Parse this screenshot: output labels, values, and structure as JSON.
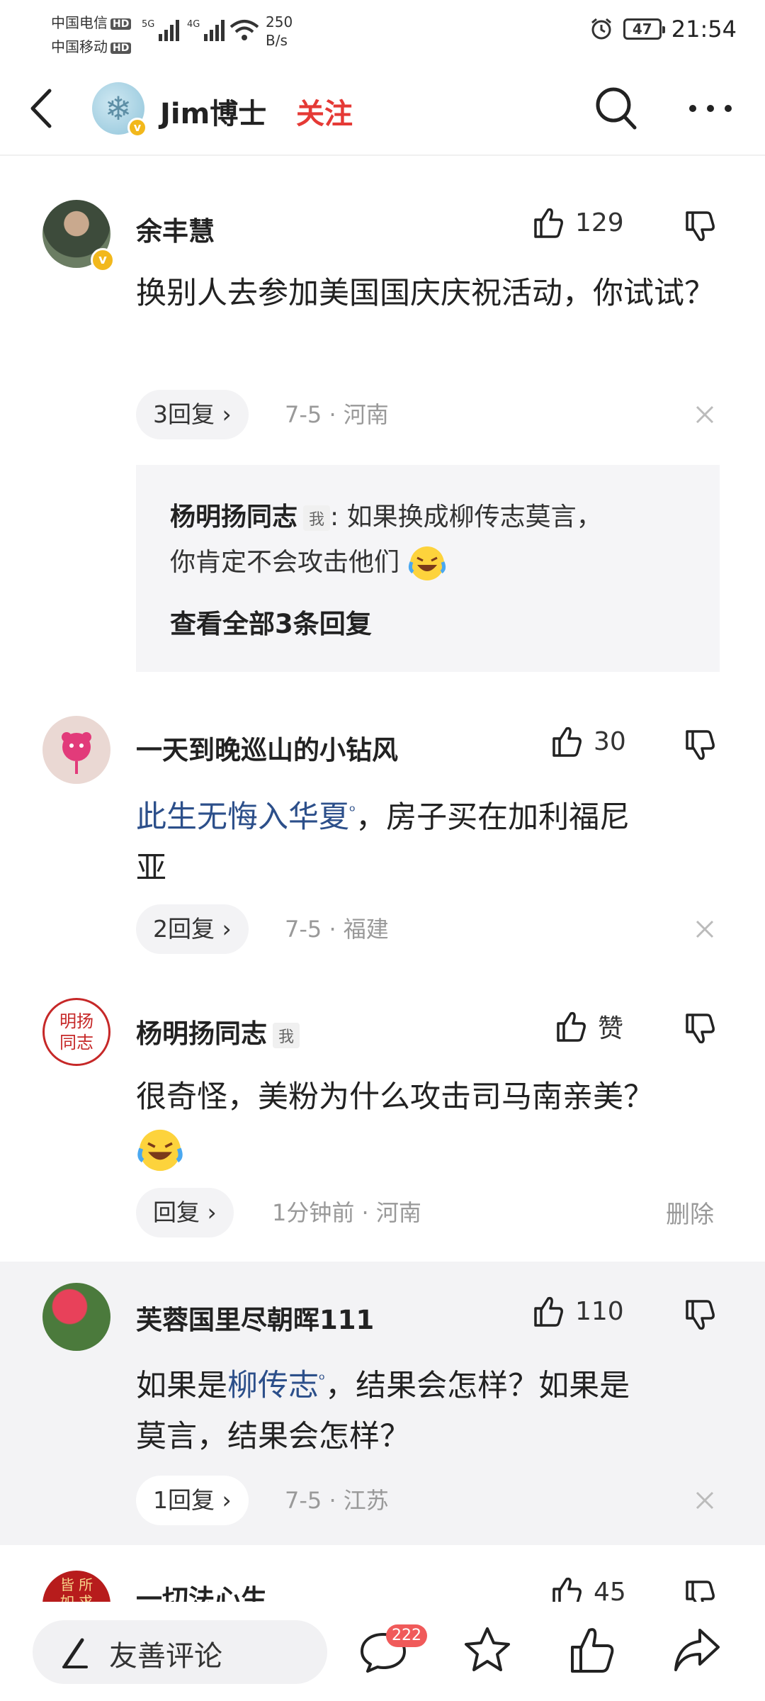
{
  "status_bar": {
    "carrier1": "中国电信",
    "carrier2": "中国移动",
    "hd": "HD",
    "sig1": "5G",
    "sig2": "4G",
    "speed_value": "250",
    "speed_unit": "B/s",
    "battery": "47",
    "time": "21:54"
  },
  "header": {
    "title": "Jim博士",
    "follow_label": "关注"
  },
  "comments": [
    {
      "name": "余丰慧",
      "likes": "129",
      "text": "换别人去参加美国国庆庆祝活动，你试试？",
      "replies_label": "3回复",
      "meta": "7-5 · 河南",
      "reply_preview": {
        "user": "杨明扬同志",
        "me_tag": "我",
        "text_line1": ": 如果换成柳传志莫言，",
        "text_line2": "你肯定不会攻击他们",
        "view_all": "查看全部3条回复"
      }
    },
    {
      "name": "一天到晚巡山的小钻风",
      "likes": "30",
      "text_link": "此生无悔入华夏",
      "text_rest_line1": "，房子买在加利福尼",
      "text_line2": "亚",
      "replies_label": "2回复",
      "meta": "7-5 · 福建"
    },
    {
      "name": "杨明扬同志",
      "me_tag": "我",
      "avatar_text_top": "明扬",
      "avatar_text_bottom": "同志",
      "likes": "赞",
      "text": "很奇怪，美粉为什么攻击司马南亲美？",
      "replies_label": "回复",
      "meta": "1分钟前 · 河南",
      "delete_label": "删除"
    },
    {
      "name": "芙蓉国里尽朝晖111",
      "likes": "110",
      "text_prefix": "如果是",
      "text_link": "柳传志",
      "text_rest_line1": "，结果会怎样？如果是",
      "text_line2": "莫言，结果会怎样？",
      "replies_label": "1回复",
      "meta": "7-5 · 江苏"
    },
    {
      "name": "一切法心生",
      "avatar_text_top": "皆 所",
      "avatar_text_bottom": "如 求",
      "likes": "45"
    }
  ],
  "bottom_bar": {
    "input_placeholder": "友善评论",
    "comment_count": "222"
  },
  "colors": {
    "accent_red": "#e53935",
    "link_blue": "#2c4f8a",
    "badge_red": "#f05a5a",
    "verified_gold": "#f2b81c"
  }
}
